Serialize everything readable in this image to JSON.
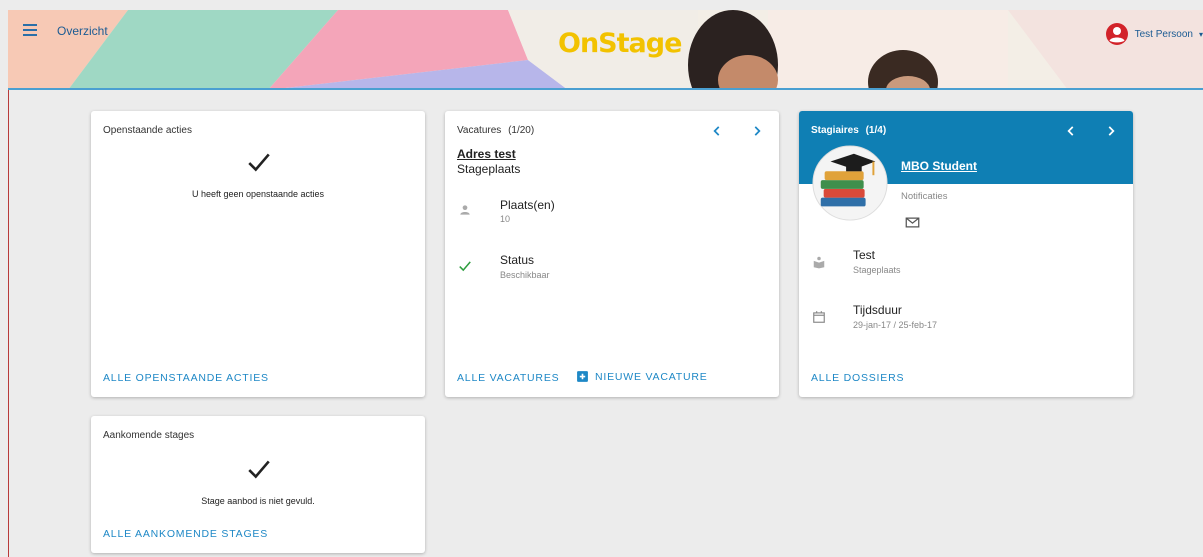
{
  "header": {
    "menu_title": "Overzicht",
    "logo_text": "OnStage",
    "user_name": "Test Persoon",
    "user_caret": "▾"
  },
  "cards": {
    "acties": {
      "title": "Openstaande acties",
      "empty_text": "U heeft geen openstaande acties",
      "link": "ALLE OPENSTAANDE ACTIES"
    },
    "vacatures": {
      "title": "Vacatures",
      "count": "(1/20)",
      "vacancy_name": "Adres test",
      "vacancy_type": "Stageplaats",
      "places_label": "Plaats(en)",
      "places_value": "10",
      "status_label": "Status",
      "status_value": "Beschikbaar",
      "link_all": "ALLE VACATURES",
      "link_new": "NIEUWE VACATURE"
    },
    "stagiaires": {
      "title": "Stagiaires",
      "count": "(1/4)",
      "student_name": "MBO Student",
      "notifications_label": "Notificaties",
      "test_label": "Test",
      "test_sub": "Stageplaats",
      "duration_label": "Tijdsduur",
      "duration_value": "29-jan-17 / 25-feb-17",
      "link": "ALLE DOSSIERS"
    },
    "aankomend": {
      "title": "Aankomende stages",
      "empty_text": "Stage aanbod is niet gevuld.",
      "link": "ALLE AANKOMENDE STAGES"
    }
  },
  "colors": {
    "accent": "#1e88c6",
    "header_blue": "#0f7fb4",
    "logo_yellow": "#f2c200",
    "check_green": "#2e9e3f",
    "avatar_red": "#d2232a"
  },
  "icons": {
    "menu": "menu-icon",
    "user": "account-circle-icon",
    "check": "check-icon",
    "person": "person-icon",
    "mail": "mail-icon",
    "book": "book-icon",
    "calendar": "calendar-icon",
    "add": "add-box-icon",
    "prev": "chevron-left-icon",
    "next": "chevron-right-icon"
  }
}
